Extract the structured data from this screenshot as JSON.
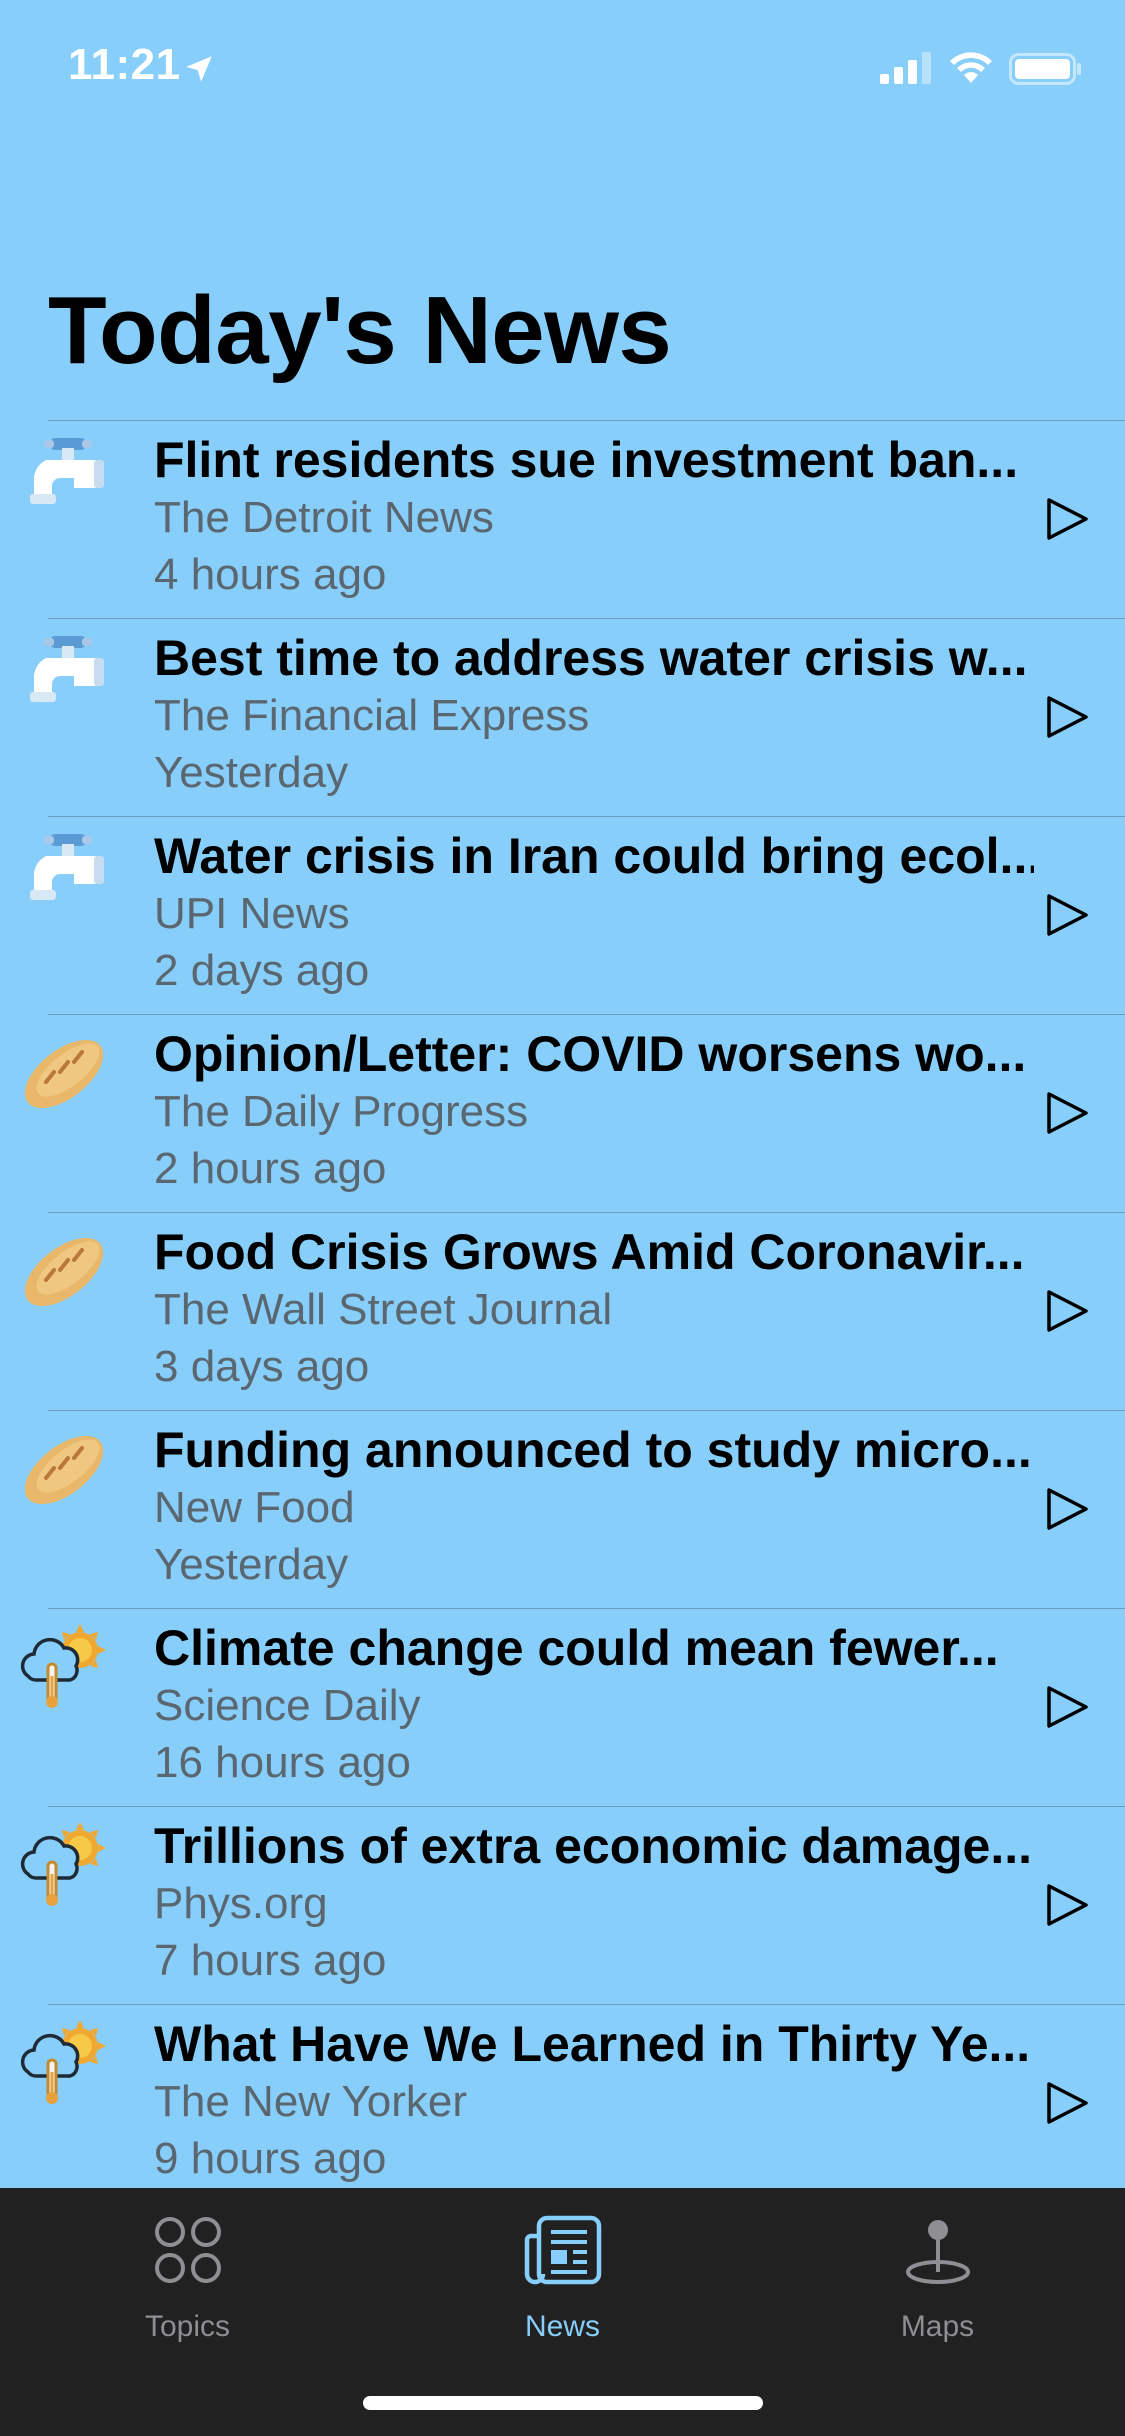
{
  "status_bar": {
    "time": "11:21"
  },
  "page": {
    "title": "Today's News"
  },
  "news": [
    {
      "headline": "Flint residents sue investment ban...",
      "source": "The Detroit News",
      "time": "4 hours ago",
      "icon": "water-faucet-icon"
    },
    {
      "headline": "Best time to address water crisis w...",
      "source": "The Financial Express",
      "time": "Yesterday",
      "icon": "water-faucet-icon"
    },
    {
      "headline": "Water crisis in Iran could bring ecol...",
      "source": "UPI News",
      "time": "2 days ago",
      "icon": "water-faucet-icon"
    },
    {
      "headline": "Opinion/Letter: COVID worsens wo...",
      "source": "The Daily Progress",
      "time": "2 hours ago",
      "icon": "bread-icon"
    },
    {
      "headline": "Food Crisis Grows Amid Coronavir...",
      "source": "The Wall Street Journal",
      "time": "3 days ago",
      "icon": "bread-icon"
    },
    {
      "headline": "Funding announced to study micro...",
      "source": "New Food",
      "time": "Yesterday",
      "icon": "bread-icon"
    },
    {
      "headline": "Climate change could mean fewer...",
      "source": "Science Daily",
      "time": "16 hours ago",
      "icon": "climate-weather-icon"
    },
    {
      "headline": "Trillions of extra economic damage...",
      "source": "Phys.org",
      "time": "7 hours ago",
      "icon": "climate-weather-icon"
    },
    {
      "headline": "What Have We Learned in Thirty Ye...",
      "source": "The New Yorker",
      "time": "9 hours ago",
      "icon": "climate-weather-icon"
    }
  ],
  "tabs": [
    {
      "label": "Topics",
      "icon": "topics-grid-icon",
      "active": false
    },
    {
      "label": "News",
      "icon": "newspaper-icon",
      "active": true
    },
    {
      "label": "Maps",
      "icon": "map-pin-icon",
      "active": false
    }
  ],
  "colors": {
    "background": "#87CEFA",
    "tab_bar": "#212121",
    "tab_active": "#87CEFA",
    "tab_inactive": "#8e8e93",
    "secondary_text": "#5b6770"
  }
}
